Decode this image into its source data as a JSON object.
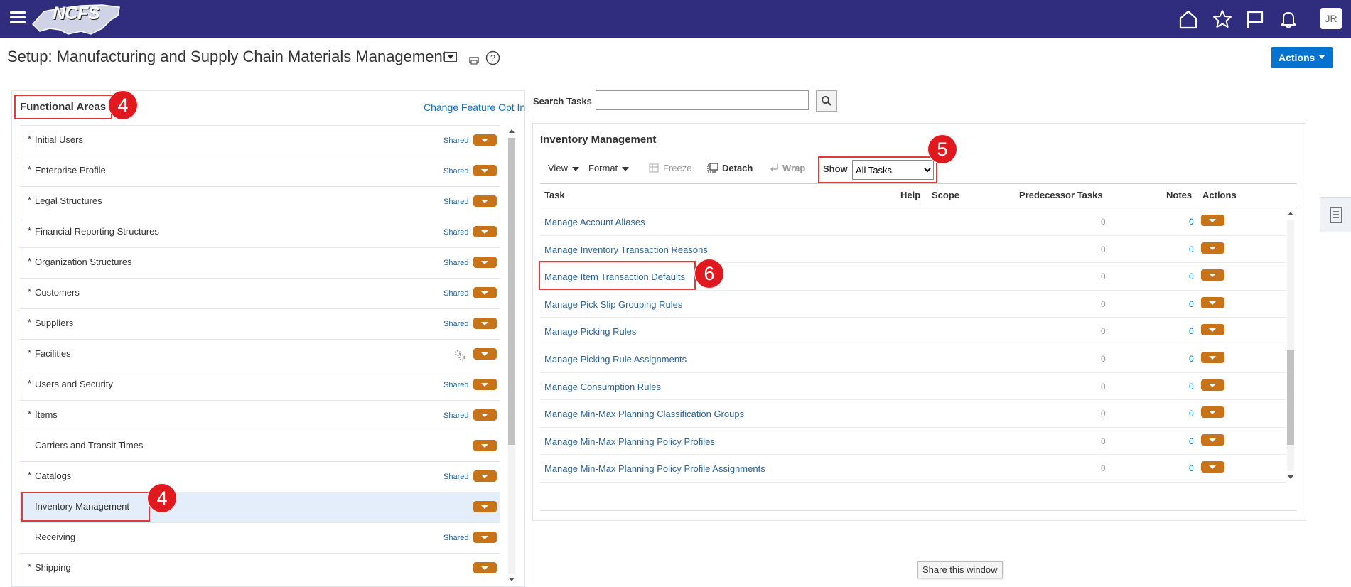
{
  "header": {
    "logo_text": "NCFS",
    "avatar_initials": "JR"
  },
  "page": {
    "title": "Setup: Manufacturing and Supply Chain Materials Management",
    "actions_label": "Actions"
  },
  "functional_areas": {
    "title": "Functional Areas",
    "change_link": "Change Feature Opt In",
    "items": [
      {
        "label": "Initial Users",
        "required": "*",
        "tag": "Shared"
      },
      {
        "label": "Enterprise Profile",
        "required": "*",
        "tag": "Shared"
      },
      {
        "label": "Legal Structures",
        "required": "*",
        "tag": "Shared"
      },
      {
        "label": "Financial Reporting Structures",
        "required": "*",
        "tag": "Shared"
      },
      {
        "label": "Organization Structures",
        "required": "*",
        "tag": "Shared"
      },
      {
        "label": "Customers",
        "required": "*",
        "tag": "Shared"
      },
      {
        "label": "Suppliers",
        "required": "*",
        "tag": "Shared"
      },
      {
        "label": "Facilities",
        "required": "*",
        "tag": "",
        "icon": "gears-icon"
      },
      {
        "label": "Users and Security",
        "required": "*",
        "tag": "Shared"
      },
      {
        "label": "Items",
        "required": "*",
        "tag": "Shared"
      },
      {
        "label": "Carriers and Transit Times",
        "required": "",
        "tag": ""
      },
      {
        "label": "Catalogs",
        "required": "*",
        "tag": "Shared"
      },
      {
        "label": "Inventory Management",
        "required": "",
        "tag": "",
        "selected": true
      },
      {
        "label": "Receiving",
        "required": "",
        "tag": "Shared"
      },
      {
        "label": "Shipping",
        "required": "*",
        "tag": ""
      }
    ]
  },
  "search": {
    "label": "Search Tasks",
    "value": ""
  },
  "tasks_panel": {
    "title": "Inventory Management",
    "toolbar": {
      "view": "View",
      "format": "Format",
      "freeze": "Freeze",
      "detach": "Detach",
      "wrap": "Wrap",
      "show_label": "Show",
      "show_value": "All Tasks"
    },
    "columns": [
      "Task",
      "Help",
      "Scope",
      "Predecessor Tasks",
      "Notes",
      "Actions"
    ],
    "rows": [
      {
        "task": "Manage Account Aliases",
        "predecessor": "0",
        "notes": "0"
      },
      {
        "task": "Manage Inventory Transaction Reasons",
        "predecessor": "0",
        "notes": "0"
      },
      {
        "task": "Manage Item Transaction Defaults",
        "predecessor": "0",
        "notes": "0"
      },
      {
        "task": "Manage Pick Slip Grouping Rules",
        "predecessor": "0",
        "notes": "0"
      },
      {
        "task": "Manage Picking Rules",
        "predecessor": "0",
        "notes": "0"
      },
      {
        "task": "Manage Picking Rule Assignments",
        "predecessor": "0",
        "notes": "0"
      },
      {
        "task": "Manage Consumption Rules",
        "predecessor": "0",
        "notes": "0"
      },
      {
        "task": "Manage Min-Max Planning Classification Groups",
        "predecessor": "0",
        "notes": "0"
      },
      {
        "task": "Manage Min-Max Planning Policy Profiles",
        "predecessor": "0",
        "notes": "0"
      },
      {
        "task": "Manage Min-Max Planning Policy Profile Assignments",
        "predecessor": "0",
        "notes": "0"
      }
    ]
  },
  "share_label": "Share this window",
  "annotations": {
    "fa_title_badge": "4",
    "inventory_badge": "4",
    "show_badge": "5",
    "item_txn_badge": "6"
  },
  "colors": {
    "header_bg": "#312d7e",
    "accent_blue": "#0572ce",
    "action_pill": "#c7731a",
    "highlight_red": "#e0191f"
  }
}
